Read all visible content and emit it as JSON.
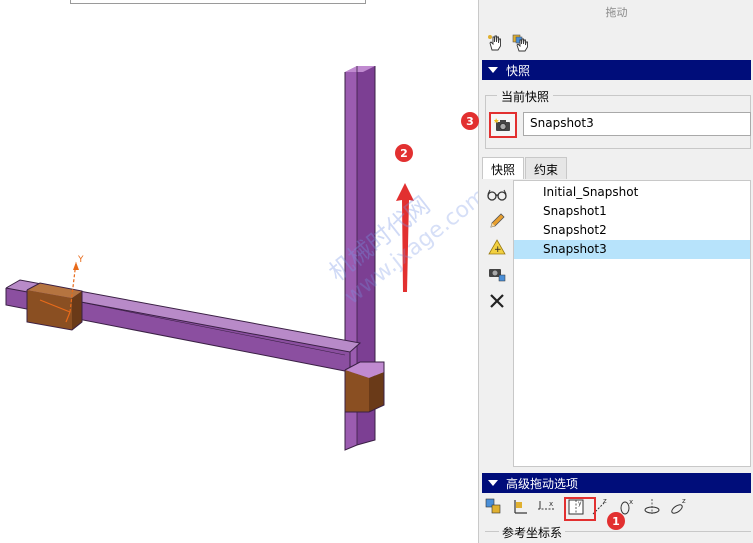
{
  "panel": {
    "title": "拖动",
    "snapshot_section": "快照",
    "current_snapshot_label": "当前快照",
    "current_snapshot_value": "Snapshot3",
    "tabs": [
      {
        "label": "快照",
        "active": true
      },
      {
        "label": "约束",
        "active": false
      }
    ],
    "snapshots": [
      {
        "label": "Initial_Snapshot",
        "selected": false
      },
      {
        "label": "Snapshot1",
        "selected": false
      },
      {
        "label": "Snapshot2",
        "selected": false
      },
      {
        "label": "Snapshot3",
        "selected": true
      }
    ],
    "advanced_section": "高级拖动选项",
    "reference_coord_label": "参考坐标系"
  },
  "viewport": {
    "axis_label_y": "Y",
    "watermark_cn": "机械时代网",
    "watermark_url": "www.jxage.com"
  },
  "annotations": {
    "badge_1": "1",
    "badge_2": "2",
    "badge_3": "3"
  },
  "colors": {
    "section_bar": "#000d7a",
    "selected_row": "#b7e3fb",
    "highlight": "#e23030",
    "profile_purple": "#8b4fa0",
    "connector_brown": "#8a4f22"
  },
  "icons": {
    "top": [
      "drag-hand-icon",
      "drag-hand-component-icon"
    ],
    "side": [
      "view-glasses-icon",
      "edit-pencil-icon",
      "add-constraint-icon",
      "camera-add-icon",
      "delete-x-icon"
    ],
    "advanced": [
      "select-component-icon",
      "coordinate-icon",
      "x-axis-icon",
      "y-axis-plane-icon",
      "z-axis-icon",
      "rotate-x-icon",
      "rotate-y-icon",
      "rotate-z-icon"
    ]
  }
}
